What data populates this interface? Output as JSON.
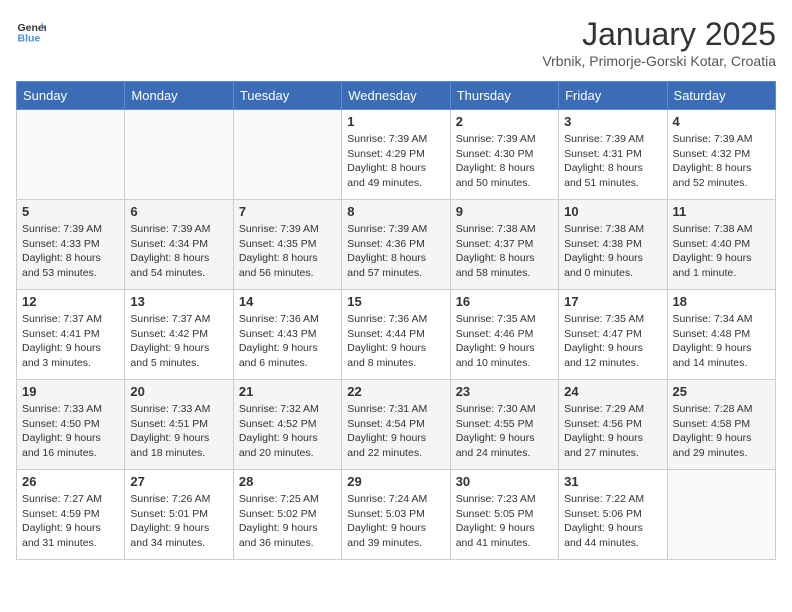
{
  "logo": {
    "general": "General",
    "blue": "Blue"
  },
  "header": {
    "title": "January 2025",
    "subtitle": "Vrbnik, Primorje-Gorski Kotar, Croatia"
  },
  "weekdays": [
    "Sunday",
    "Monday",
    "Tuesday",
    "Wednesday",
    "Thursday",
    "Friday",
    "Saturday"
  ],
  "weeks": [
    [
      {
        "day": "",
        "info": ""
      },
      {
        "day": "",
        "info": ""
      },
      {
        "day": "",
        "info": ""
      },
      {
        "day": "1",
        "info": "Sunrise: 7:39 AM\nSunset: 4:29 PM\nDaylight: 8 hours\nand 49 minutes."
      },
      {
        "day": "2",
        "info": "Sunrise: 7:39 AM\nSunset: 4:30 PM\nDaylight: 8 hours\nand 50 minutes."
      },
      {
        "day": "3",
        "info": "Sunrise: 7:39 AM\nSunset: 4:31 PM\nDaylight: 8 hours\nand 51 minutes."
      },
      {
        "day": "4",
        "info": "Sunrise: 7:39 AM\nSunset: 4:32 PM\nDaylight: 8 hours\nand 52 minutes."
      }
    ],
    [
      {
        "day": "5",
        "info": "Sunrise: 7:39 AM\nSunset: 4:33 PM\nDaylight: 8 hours\nand 53 minutes."
      },
      {
        "day": "6",
        "info": "Sunrise: 7:39 AM\nSunset: 4:34 PM\nDaylight: 8 hours\nand 54 minutes."
      },
      {
        "day": "7",
        "info": "Sunrise: 7:39 AM\nSunset: 4:35 PM\nDaylight: 8 hours\nand 56 minutes."
      },
      {
        "day": "8",
        "info": "Sunrise: 7:39 AM\nSunset: 4:36 PM\nDaylight: 8 hours\nand 57 minutes."
      },
      {
        "day": "9",
        "info": "Sunrise: 7:38 AM\nSunset: 4:37 PM\nDaylight: 8 hours\nand 58 minutes."
      },
      {
        "day": "10",
        "info": "Sunrise: 7:38 AM\nSunset: 4:38 PM\nDaylight: 9 hours\nand 0 minutes."
      },
      {
        "day": "11",
        "info": "Sunrise: 7:38 AM\nSunset: 4:40 PM\nDaylight: 9 hours\nand 1 minute."
      }
    ],
    [
      {
        "day": "12",
        "info": "Sunrise: 7:37 AM\nSunset: 4:41 PM\nDaylight: 9 hours\nand 3 minutes."
      },
      {
        "day": "13",
        "info": "Sunrise: 7:37 AM\nSunset: 4:42 PM\nDaylight: 9 hours\nand 5 minutes."
      },
      {
        "day": "14",
        "info": "Sunrise: 7:36 AM\nSunset: 4:43 PM\nDaylight: 9 hours\nand 6 minutes."
      },
      {
        "day": "15",
        "info": "Sunrise: 7:36 AM\nSunset: 4:44 PM\nDaylight: 9 hours\nand 8 minutes."
      },
      {
        "day": "16",
        "info": "Sunrise: 7:35 AM\nSunset: 4:46 PM\nDaylight: 9 hours\nand 10 minutes."
      },
      {
        "day": "17",
        "info": "Sunrise: 7:35 AM\nSunset: 4:47 PM\nDaylight: 9 hours\nand 12 minutes."
      },
      {
        "day": "18",
        "info": "Sunrise: 7:34 AM\nSunset: 4:48 PM\nDaylight: 9 hours\nand 14 minutes."
      }
    ],
    [
      {
        "day": "19",
        "info": "Sunrise: 7:33 AM\nSunset: 4:50 PM\nDaylight: 9 hours\nand 16 minutes."
      },
      {
        "day": "20",
        "info": "Sunrise: 7:33 AM\nSunset: 4:51 PM\nDaylight: 9 hours\nand 18 minutes."
      },
      {
        "day": "21",
        "info": "Sunrise: 7:32 AM\nSunset: 4:52 PM\nDaylight: 9 hours\nand 20 minutes."
      },
      {
        "day": "22",
        "info": "Sunrise: 7:31 AM\nSunset: 4:54 PM\nDaylight: 9 hours\nand 22 minutes."
      },
      {
        "day": "23",
        "info": "Sunrise: 7:30 AM\nSunset: 4:55 PM\nDaylight: 9 hours\nand 24 minutes."
      },
      {
        "day": "24",
        "info": "Sunrise: 7:29 AM\nSunset: 4:56 PM\nDaylight: 9 hours\nand 27 minutes."
      },
      {
        "day": "25",
        "info": "Sunrise: 7:28 AM\nSunset: 4:58 PM\nDaylight: 9 hours\nand 29 minutes."
      }
    ],
    [
      {
        "day": "26",
        "info": "Sunrise: 7:27 AM\nSunset: 4:59 PM\nDaylight: 9 hours\nand 31 minutes."
      },
      {
        "day": "27",
        "info": "Sunrise: 7:26 AM\nSunset: 5:01 PM\nDaylight: 9 hours\nand 34 minutes."
      },
      {
        "day": "28",
        "info": "Sunrise: 7:25 AM\nSunset: 5:02 PM\nDaylight: 9 hours\nand 36 minutes."
      },
      {
        "day": "29",
        "info": "Sunrise: 7:24 AM\nSunset: 5:03 PM\nDaylight: 9 hours\nand 39 minutes."
      },
      {
        "day": "30",
        "info": "Sunrise: 7:23 AM\nSunset: 5:05 PM\nDaylight: 9 hours\nand 41 minutes."
      },
      {
        "day": "31",
        "info": "Sunrise: 7:22 AM\nSunset: 5:06 PM\nDaylight: 9 hours\nand 44 minutes."
      },
      {
        "day": "",
        "info": ""
      }
    ]
  ]
}
